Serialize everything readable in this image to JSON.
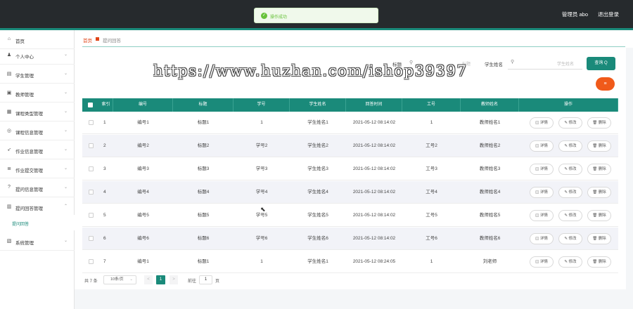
{
  "topbar": {
    "user": "管理员 abo",
    "logout": "退出登录"
  },
  "toast": {
    "message": "操作成功"
  },
  "sidebar": {
    "items": [
      {
        "icon": "home-icon",
        "glyph": "⌂",
        "label": "首页",
        "chevron": ""
      },
      {
        "icon": "user-icon",
        "glyph": "♟",
        "label": "个人中心",
        "chevron": "⌄"
      },
      {
        "icon": "id-card-icon",
        "glyph": "▤",
        "label": "学生管理",
        "chevron": "⌄"
      },
      {
        "icon": "teacher-icon",
        "glyph": "▣",
        "label": "教师管理",
        "chevron": "⌄"
      },
      {
        "icon": "grid-icon",
        "glyph": "▦",
        "label": "课程类型管理",
        "chevron": "⌄"
      },
      {
        "icon": "globe-icon",
        "glyph": "◎",
        "label": "课程信息管理",
        "chevron": "⌄"
      },
      {
        "icon": "send-icon",
        "glyph": "➶",
        "label": "作业信息管理",
        "chevron": "⌄"
      },
      {
        "icon": "stack-icon",
        "glyph": "≣",
        "label": "作业提交管理",
        "chevron": "⌄"
      },
      {
        "icon": "question-icon",
        "glyph": "?",
        "label": "提问信息管理",
        "chevron": "⌄"
      },
      {
        "icon": "doc-icon",
        "glyph": "▥",
        "label": "提问回答管理",
        "chevron": "⌃"
      },
      {
        "icon": "settings-icon",
        "glyph": "▧",
        "label": "系统管理",
        "chevron": "⌄"
      }
    ],
    "sub_item": "提问回答"
  },
  "breadcrumb": {
    "home": "首页",
    "current": "提问回答"
  },
  "search": {
    "label": "标题",
    "icon": "search-icon",
    "placeholder": "标题",
    "student_label": "学生姓名",
    "student_placeholder": "学生姓名",
    "query_button": "查询 Q",
    "orange_button": "≡"
  },
  "watermark": "https://www.huzhan.com/ishop39397",
  "table": {
    "headers": [
      "索引",
      "编号",
      "标题",
      "学号",
      "学生姓名",
      "回答时间",
      "工号",
      "教师姓名",
      "操作"
    ],
    "rows": [
      {
        "index": "1",
        "code": "编号1",
        "title": "标题1",
        "stu_no": "1",
        "stu_name": "学生姓名1",
        "time": "2021-05-12 08:14:02",
        "work_no": "1",
        "teacher": "教师姓名1"
      },
      {
        "index": "2",
        "code": "编号2",
        "title": "标题2",
        "stu_no": "学号2",
        "stu_name": "学生姓名2",
        "time": "2021-05-12 08:14:02",
        "work_no": "工号2",
        "teacher": "教师姓名2"
      },
      {
        "index": "3",
        "code": "编号3",
        "title": "标题3",
        "stu_no": "学号3",
        "stu_name": "学生姓名3",
        "time": "2021-05-12 08:14:02",
        "work_no": "工号3",
        "teacher": "教师姓名3"
      },
      {
        "index": "4",
        "code": "编号4",
        "title": "标题4",
        "stu_no": "学号4",
        "stu_name": "学生姓名4",
        "time": "2021-05-12 08:14:02",
        "work_no": "工号4",
        "teacher": "教师姓名4"
      },
      {
        "index": "5",
        "code": "编号5",
        "title": "标题5",
        "stu_no": "学号5",
        "stu_name": "学生姓名5",
        "time": "2021-05-12 08:14:02",
        "work_no": "工号5",
        "teacher": "教师姓名5"
      },
      {
        "index": "6",
        "code": "编号6",
        "title": "标题6",
        "stu_no": "学号6",
        "stu_name": "学生姓名6",
        "time": "2021-05-12 08:14:02",
        "work_no": "工号6",
        "teacher": "教师姓名6"
      },
      {
        "index": "7",
        "code": "编号1",
        "title": "标题1",
        "stu_no": "1",
        "stu_name": "学生姓名1",
        "time": "2021-05-12 08:24:05",
        "work_no": "1",
        "teacher": "刘老师"
      }
    ],
    "actions": {
      "detail": "◫ 详情",
      "edit": "✎ 修改",
      "delete": "🗑 删除"
    }
  },
  "pagination": {
    "total": "共 7 条",
    "page_size": "10条/页",
    "prev": "<",
    "current_page": "1",
    "next": ">",
    "goto_label": "前往",
    "goto_value": "1",
    "page_unit": "页"
  }
}
